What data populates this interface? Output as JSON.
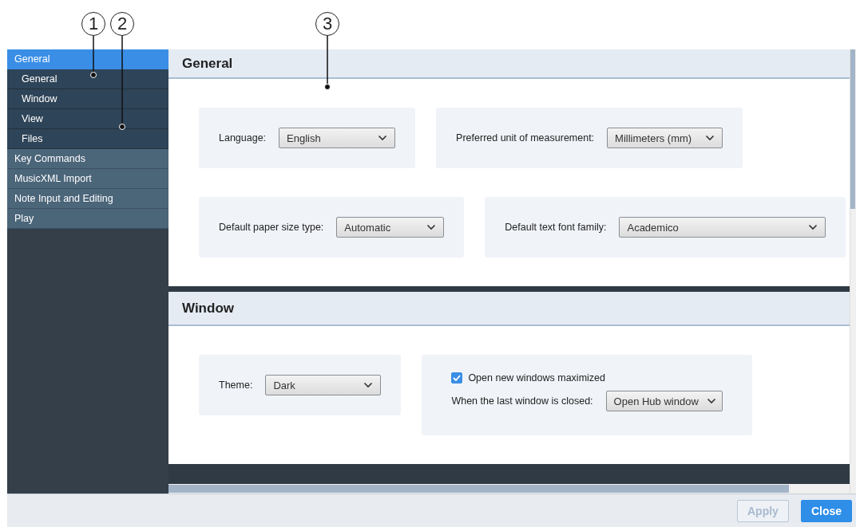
{
  "callouts": [
    {
      "label": "1"
    },
    {
      "label": "2"
    },
    {
      "label": "3"
    }
  ],
  "sidebar": {
    "items": [
      {
        "label": "General",
        "selected": true,
        "children": [
          {
            "label": "General",
            "selected": false
          },
          {
            "label": "Window",
            "selected": false
          },
          {
            "label": "View",
            "selected": false
          },
          {
            "label": "Files",
            "selected": false
          }
        ]
      },
      {
        "label": "Key Commands",
        "selected": false
      },
      {
        "label": "MusicXML Import",
        "selected": false
      },
      {
        "label": "Note Input and Editing",
        "selected": false
      },
      {
        "label": "Play",
        "selected": false
      }
    ]
  },
  "sections": [
    {
      "title": "General",
      "rows": [
        {
          "panels": [
            {
              "fields": [
                {
                  "kind": "select",
                  "label": "Language:",
                  "value": "English"
                }
              ]
            },
            {
              "fields": [
                {
                  "kind": "select",
                  "label": "Preferred unit of measurement:",
                  "value": "Millimeters (mm)"
                }
              ]
            }
          ]
        },
        {
          "panels": [
            {
              "fields": [
                {
                  "kind": "select",
                  "label": "Default paper size type:",
                  "value": "Automatic"
                }
              ]
            },
            {
              "fields": [
                {
                  "kind": "select",
                  "label": "Default text font family:",
                  "value": "Academico"
                }
              ]
            }
          ]
        }
      ]
    },
    {
      "title": "Window",
      "rows": [
        {
          "panels": [
            {
              "fields": [
                {
                  "kind": "select",
                  "label": "Theme:",
                  "value": "Dark"
                }
              ]
            },
            {
              "fields": [
                {
                  "kind": "checkbox",
                  "label": "Open new windows maximized",
                  "checked": true
                },
                {
                  "kind": "select",
                  "label": "When the last window is closed:",
                  "value": "Open Hub window"
                }
              ]
            }
          ]
        }
      ]
    }
  ],
  "buttons": [
    {
      "label": "Apply",
      "disabled": true,
      "primary": false
    },
    {
      "label": "Close",
      "disabled": false,
      "primary": true
    }
  ]
}
